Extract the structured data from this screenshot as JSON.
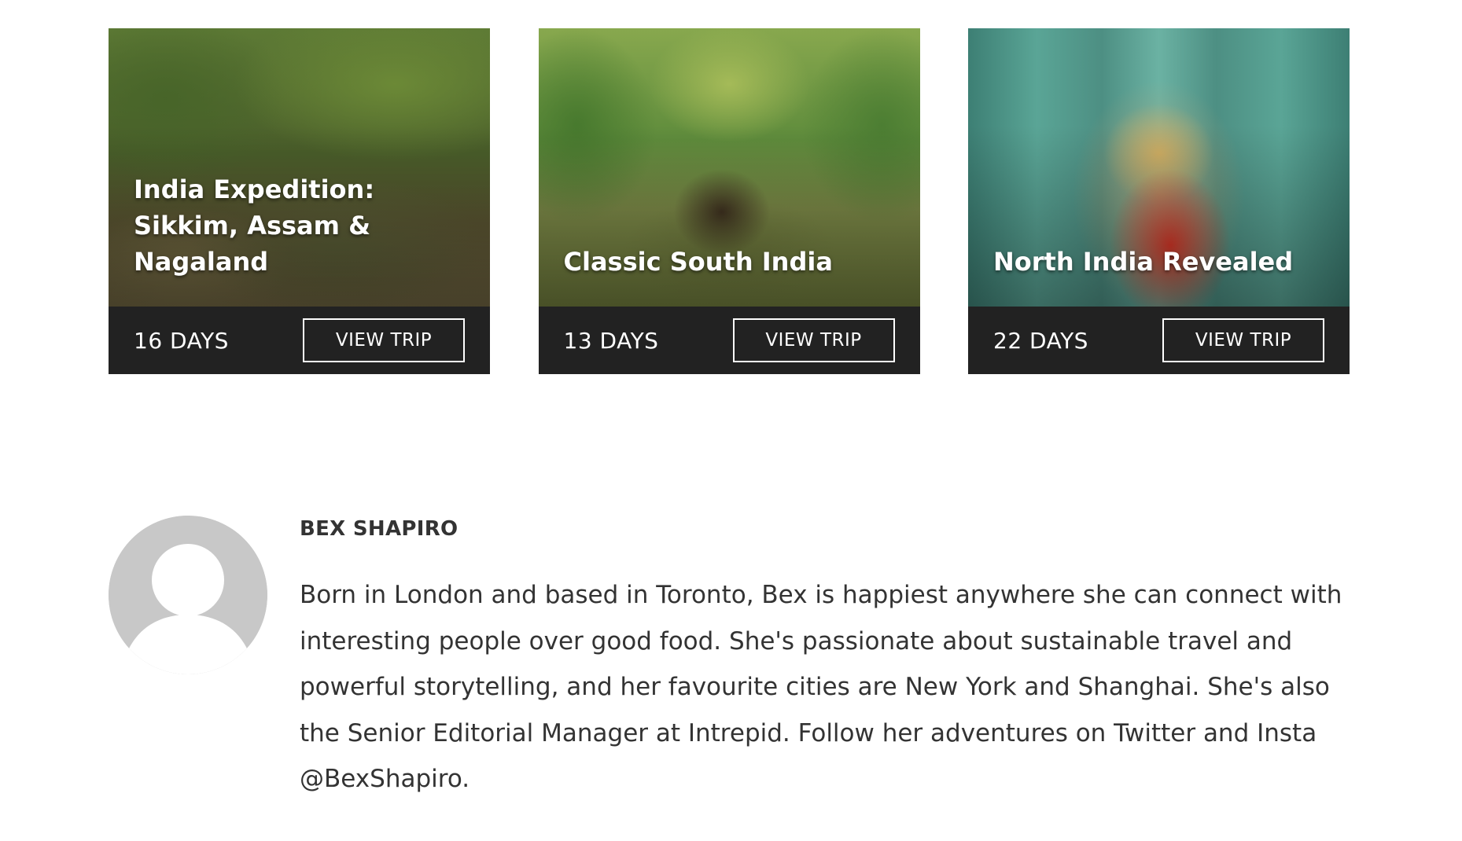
{
  "trips": [
    {
      "title": "India Expedition: Sikkim, Assam & Nagaland",
      "duration": "16 DAYS",
      "button_label": "VIEW TRIP"
    },
    {
      "title": "Classic South India",
      "duration": "13 DAYS",
      "button_label": "VIEW TRIP"
    },
    {
      "title": "North India Revealed",
      "duration": "22 DAYS",
      "button_label": "VIEW TRIP"
    }
  ],
  "author": {
    "name": "BEX SHAPIRO",
    "bio": "Born in London and based in Toronto, Bex is happiest anywhere she can connect with interesting people over good food. She's passionate about sustainable travel and powerful storytelling, and her favourite cities are New York and Shanghai. She's also the Senior Editorial Manager at Intrepid. Follow her adventures on Twitter and Insta @BexShapiro."
  },
  "colors": {
    "card_footer": "#222222",
    "button_border": "#ffffff",
    "body_text": "#333333",
    "avatar_gray": "#c8c8c8"
  }
}
